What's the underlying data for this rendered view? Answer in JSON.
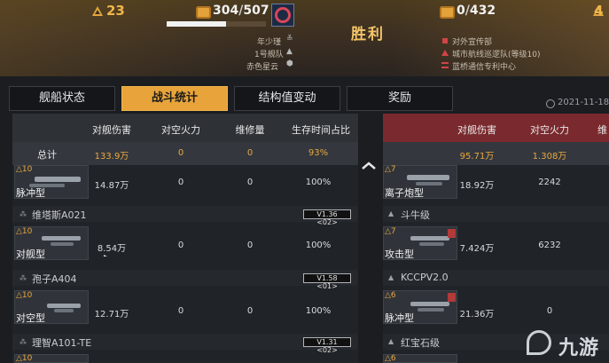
{
  "banner": {
    "left_rank": "23",
    "resource_left": {
      "current": "304",
      "total": "507",
      "progress": 0.6
    },
    "result_title": "胜利",
    "resource_right": {
      "current": "0",
      "total": "432"
    },
    "right_rank": "4",
    "left_team": [
      "年少瑾",
      "1号舰队",
      "赤色星云"
    ],
    "right_team": [
      "对外宣传部",
      "城市航线巡逻队(等级10)",
      "蓝桥通信专利中心"
    ]
  },
  "tabs": [
    {
      "label": "舰船状态",
      "active": false
    },
    {
      "label": "战斗统计",
      "active": true
    },
    {
      "label": "结构值变动",
      "active": false
    },
    {
      "label": "奖励",
      "active": false
    }
  ],
  "date": "2021-11-18 18",
  "left_table": {
    "headers": [
      "对舰伤害",
      "对空火力",
      "维修量",
      "生存时间占比"
    ],
    "total_label": "总计",
    "totals": [
      "133.9万",
      "0",
      "0",
      "93%"
    ],
    "rows": [
      {
        "level": "10",
        "type": "脉冲型",
        "values": [
          "14.87万",
          "0",
          "0",
          "100%"
        ]
      },
      {
        "group": "维塔斯A021",
        "version": "V1.36 <02>"
      },
      {
        "level": "10",
        "type": "对舰型",
        "values": [
          "8.54万",
          "0",
          "0",
          "100%"
        ]
      },
      {
        "group": "孢子A404",
        "version": "V1.58 <01>"
      },
      {
        "level": "10",
        "type": "对空型",
        "values": [
          "12.71万",
          "0",
          "0",
          "100%"
        ]
      },
      {
        "group": "理智A101-TE",
        "version": "V1.31 <02>"
      },
      {
        "level": "10"
      }
    ]
  },
  "right_table": {
    "headers": [
      "对舰伤害",
      "对空火力",
      "维"
    ],
    "totals": [
      "95.71万",
      "1.308万"
    ],
    "rows": [
      {
        "level": "7",
        "type": "离子炮型",
        "values": [
          "18.92万",
          "2242"
        ]
      },
      {
        "group": "斗牛级"
      },
      {
        "level": "7",
        "type": "攻击型",
        "values": [
          "7.424万",
          "6232"
        ]
      },
      {
        "group": "KCCPV2.0"
      },
      {
        "level": "6",
        "type": "脉冲型",
        "values": [
          "21.36万",
          "0"
        ]
      },
      {
        "group": "红宝石级"
      },
      {
        "level": "6"
      }
    ]
  },
  "watermark": "九游",
  "colors": {
    "accent": "#e8a43a",
    "enemy_header": "#7a2a2e",
    "value_gold": "#e9a63f"
  }
}
